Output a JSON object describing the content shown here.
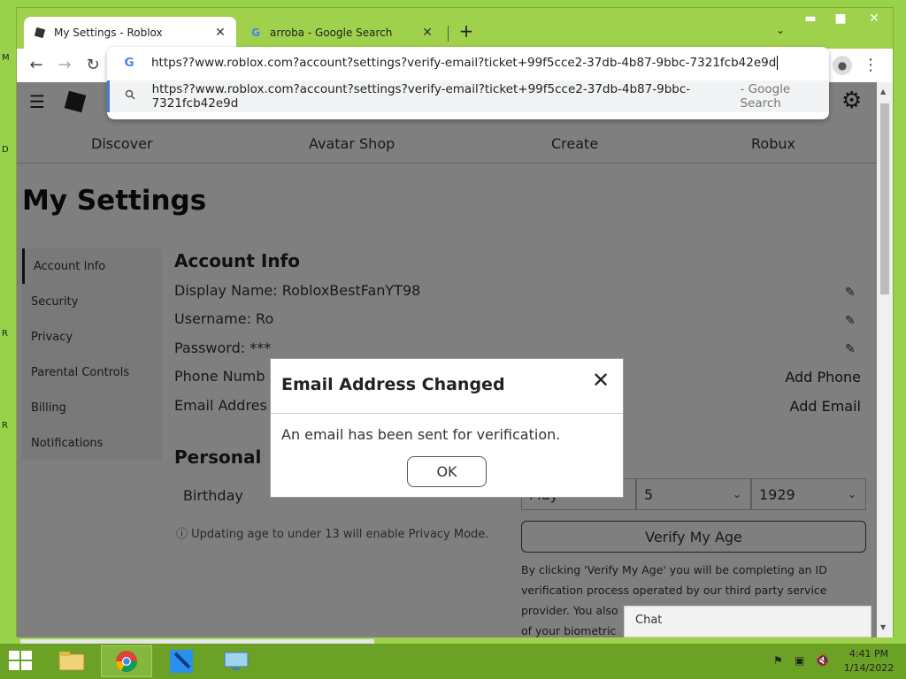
{
  "desktop": {
    "letters": [
      "M",
      "D",
      "R",
      "R"
    ]
  },
  "browser": {
    "tabs": [
      {
        "title": "My Settings - Roblox",
        "icon": "roblox-icon"
      },
      {
        "title": "arroba - Google Search",
        "icon": "google-icon"
      }
    ],
    "new_tab": "+",
    "tab_menu": "⌄",
    "window_controls": {
      "minimize": "▬",
      "maximize": "■",
      "close": "✕"
    },
    "address_input": "https??www.roblox.com?account?settings?verify-email?ticket+99f5cce2-37db-4b87-9bbc-7321fcb42e9d",
    "suggestion": {
      "text": "https??www.roblox.com?account?settings?verify-email?ticket+99f5cce2-37db-4b87-9bbc-7321fcb42e9d",
      "hint": "- Google Search"
    },
    "nav_icons": {
      "back": "←",
      "forward": "→",
      "reload": "↻",
      "menu": "⋮"
    }
  },
  "page": {
    "nav": [
      "Discover",
      "Avatar Shop",
      "Create",
      "Robux"
    ],
    "title": "My Settings",
    "sidebar": [
      {
        "label": "Account Info",
        "active": true
      },
      {
        "label": "Security"
      },
      {
        "label": "Privacy"
      },
      {
        "label": "Parental Controls"
      },
      {
        "label": "Billing"
      },
      {
        "label": "Notifications"
      }
    ],
    "account_info": {
      "heading": "Account Info",
      "display_name": "Display Name: RobloxBestFanYT98",
      "username": "Username: Ro",
      "password": "Password: ***",
      "phone": "Phone Numb",
      "email": "Email Addres",
      "add_phone": "Add Phone",
      "add_email": "Add Email"
    },
    "personal": {
      "heading": "Personal",
      "birthday_label": "Birthday",
      "month": "May",
      "day": "5",
      "year": "1929",
      "age_note": "Updating age to under 13 will enable Privacy Mode.",
      "verify_button": "Verify My Age",
      "verify_text": "By clicking 'Verify My Age' you will be completing an ID verification process operated by our third party service provider. You also",
      "verify_text_2": "of your biometric"
    },
    "chat_label": "Chat"
  },
  "modal": {
    "title": "Email Address Changed",
    "body": "An email has been sent for verification.",
    "ok": "OK"
  },
  "taskbar": {
    "time": "4:41 PM",
    "date": "1/14/2022"
  }
}
